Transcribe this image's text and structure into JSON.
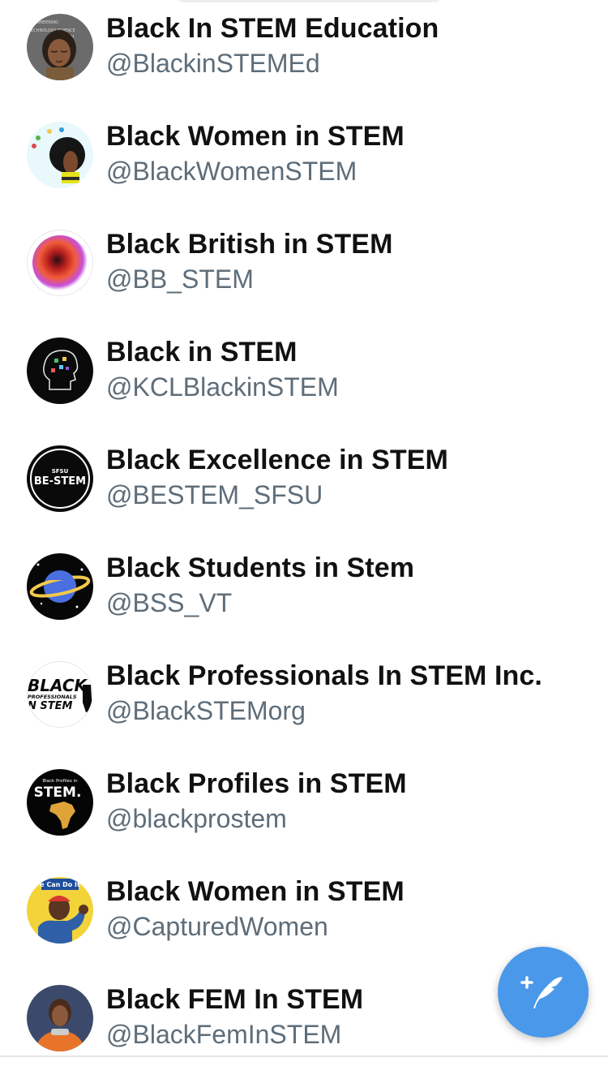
{
  "accounts": [
    {
      "name": "Black In STEM Education",
      "handle": "@BlackinSTEMEd",
      "avatar_icon": "woman-wordcloud-avatar-icon"
    },
    {
      "name": "Black Women in STEM",
      "handle": "@BlackWomenSTEM",
      "avatar_icon": "afro-woman-profile-avatar-icon"
    },
    {
      "name": "Black British in STEM",
      "handle": "@BB_STEM",
      "avatar_icon": "gradient-blob-avatar-icon"
    },
    {
      "name": "Black in STEM",
      "handle": "@KCLBlackinSTEM",
      "avatar_icon": "head-silhouette-avatar-icon"
    },
    {
      "name": "Black Excellence in STEM",
      "handle": "@BESTEM_SFSU",
      "avatar_icon": "be-stem-badge-avatar-icon",
      "avatar_text": {
        "top": "SFSU",
        "main": "BE-STEM"
      }
    },
    {
      "name": "Black Students in Stem",
      "handle": "@BSS_VT",
      "avatar_icon": "planet-avatar-icon"
    },
    {
      "name": "Black Professionals In STEM Inc.",
      "handle": "@BlackSTEMorg",
      "avatar_icon": "bpstem-logo-avatar-icon",
      "avatar_text": {
        "line1": "BLACK",
        "line2": "PROFESSIONALS",
        "line3": "N STEM"
      }
    },
    {
      "name": "Black Profiles in STEM",
      "handle": "@blackprostem",
      "avatar_icon": "africa-map-avatar-icon",
      "avatar_text": {
        "top": "Black Profiles in",
        "main": "STEM."
      }
    },
    {
      "name": "Black Women in STEM",
      "handle": "@CapturedWomen",
      "avatar_icon": "we-can-do-it-avatar-icon",
      "avatar_text": {
        "top": "e Can Do It"
      }
    },
    {
      "name": "Black FEM In STEM",
      "handle": "@BlackFemInSTEM",
      "avatar_icon": "astronaut-portrait-avatar-icon"
    }
  ],
  "compose_button": {
    "icon": "compose-tweet-icon",
    "color": "#4a98e9"
  },
  "colors": {
    "name": "#111111",
    "handle": "#5e6d79"
  }
}
